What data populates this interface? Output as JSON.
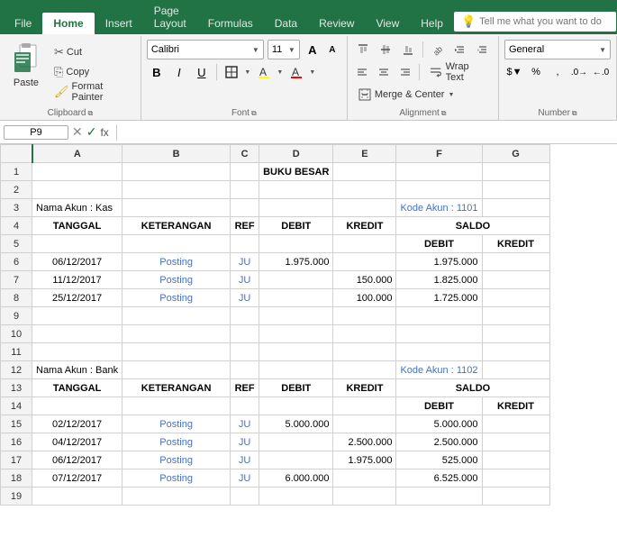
{
  "menu": {
    "items": [
      "File",
      "Home",
      "Insert",
      "Page Layout",
      "Formulas",
      "Data",
      "Review",
      "View",
      "Help"
    ],
    "active": "Home",
    "tell_me_placeholder": "Tell me what you want to do"
  },
  "ribbon": {
    "clipboard": {
      "label": "Clipboard",
      "paste": "Paste",
      "cut": "Cut",
      "copy": "Copy",
      "format_painter": "Format Painter"
    },
    "font": {
      "label": "Font",
      "font_name": "Calibri",
      "font_size": "11",
      "bold": "B",
      "italic": "I",
      "underline": "U"
    },
    "alignment": {
      "label": "Alignment",
      "wrap_text": "Wrap Text",
      "merge_center": "Merge & Center"
    },
    "number": {
      "label": "Number",
      "format": "General"
    }
  },
  "formula_bar": {
    "cell": "P9",
    "formula": ""
  },
  "spreadsheet": {
    "columns": [
      "A",
      "B",
      "C",
      "D",
      "E",
      "F",
      "G"
    ],
    "rows": [
      {
        "num": 1,
        "cells": {
          "A": "",
          "B": "",
          "C": "",
          "D": "BUKU BESAR",
          "E": "",
          "F": "",
          "G": ""
        }
      },
      {
        "num": 2,
        "cells": {
          "A": "",
          "B": "",
          "C": "",
          "D": "",
          "E": "",
          "F": "",
          "G": ""
        }
      },
      {
        "num": 3,
        "cells": {
          "A": "Nama Akun : Kas",
          "B": "",
          "C": "",
          "D": "",
          "E": "",
          "F": "Kode Akun : 1101",
          "G": ""
        }
      },
      {
        "num": 4,
        "cells": {
          "A": "TANGGAL",
          "B": "KETERANGAN",
          "C": "REF",
          "D": "DEBIT",
          "E": "KREDIT",
          "F": "SALDO",
          "G": ""
        }
      },
      {
        "num": 5,
        "cells": {
          "A": "",
          "B": "",
          "C": "",
          "D": "",
          "E": "",
          "F": "DEBIT",
          "G": "KREDIT"
        }
      },
      {
        "num": 6,
        "cells": {
          "A": "06/12/2017",
          "B": "Posting",
          "C": "JU",
          "D": "1.975.000",
          "E": "",
          "F": "1.975.000",
          "G": ""
        }
      },
      {
        "num": 7,
        "cells": {
          "A": "11/12/2017",
          "B": "Posting",
          "C": "JU",
          "D": "",
          "E": "150.000",
          "F": "1.825.000",
          "G": ""
        }
      },
      {
        "num": 8,
        "cells": {
          "A": "25/12/2017",
          "B": "Posting",
          "C": "JU",
          "D": "",
          "E": "100.000",
          "F": "1.725.000",
          "G": ""
        }
      },
      {
        "num": 9,
        "cells": {
          "A": "",
          "B": "",
          "C": "",
          "D": "",
          "E": "",
          "F": "",
          "G": ""
        }
      },
      {
        "num": 10,
        "cells": {
          "A": "",
          "B": "",
          "C": "",
          "D": "",
          "E": "",
          "F": "",
          "G": ""
        }
      },
      {
        "num": 11,
        "cells": {
          "A": "",
          "B": "",
          "C": "",
          "D": "",
          "E": "",
          "F": "",
          "G": ""
        }
      },
      {
        "num": 12,
        "cells": {
          "A": "Nama Akun : Bank",
          "B": "",
          "C": "",
          "D": "",
          "E": "",
          "F": "Kode Akun : 1102",
          "G": ""
        }
      },
      {
        "num": 13,
        "cells": {
          "A": "TANGGAL",
          "B": "KETERANGAN",
          "C": "REF",
          "D": "DEBIT",
          "E": "KREDIT",
          "F": "SALDO",
          "G": ""
        }
      },
      {
        "num": 14,
        "cells": {
          "A": "",
          "B": "",
          "C": "",
          "D": "",
          "E": "",
          "F": "DEBIT",
          "G": "KREDIT"
        }
      },
      {
        "num": 15,
        "cells": {
          "A": "02/12/2017",
          "B": "Posting",
          "C": "JU",
          "D": "5.000.000",
          "E": "",
          "F": "5.000.000",
          "G": ""
        }
      },
      {
        "num": 16,
        "cells": {
          "A": "04/12/2017",
          "B": "Posting",
          "C": "JU",
          "D": "",
          "E": "2.500.000",
          "F": "2.500.000",
          "G": ""
        }
      },
      {
        "num": 17,
        "cells": {
          "A": "06/12/2017",
          "B": "Posting",
          "C": "JU",
          "D": "",
          "E": "1.975.000",
          "F": "525.000",
          "G": ""
        }
      },
      {
        "num": 18,
        "cells": {
          "A": "07/12/2017",
          "B": "Posting",
          "C": "JU",
          "D": "6.000.000",
          "E": "",
          "F": "6.525.000",
          "G": ""
        }
      },
      {
        "num": 19,
        "cells": {
          "A": "",
          "B": "",
          "C": "",
          "D": "",
          "E": "",
          "F": "",
          "G": ""
        }
      }
    ]
  }
}
